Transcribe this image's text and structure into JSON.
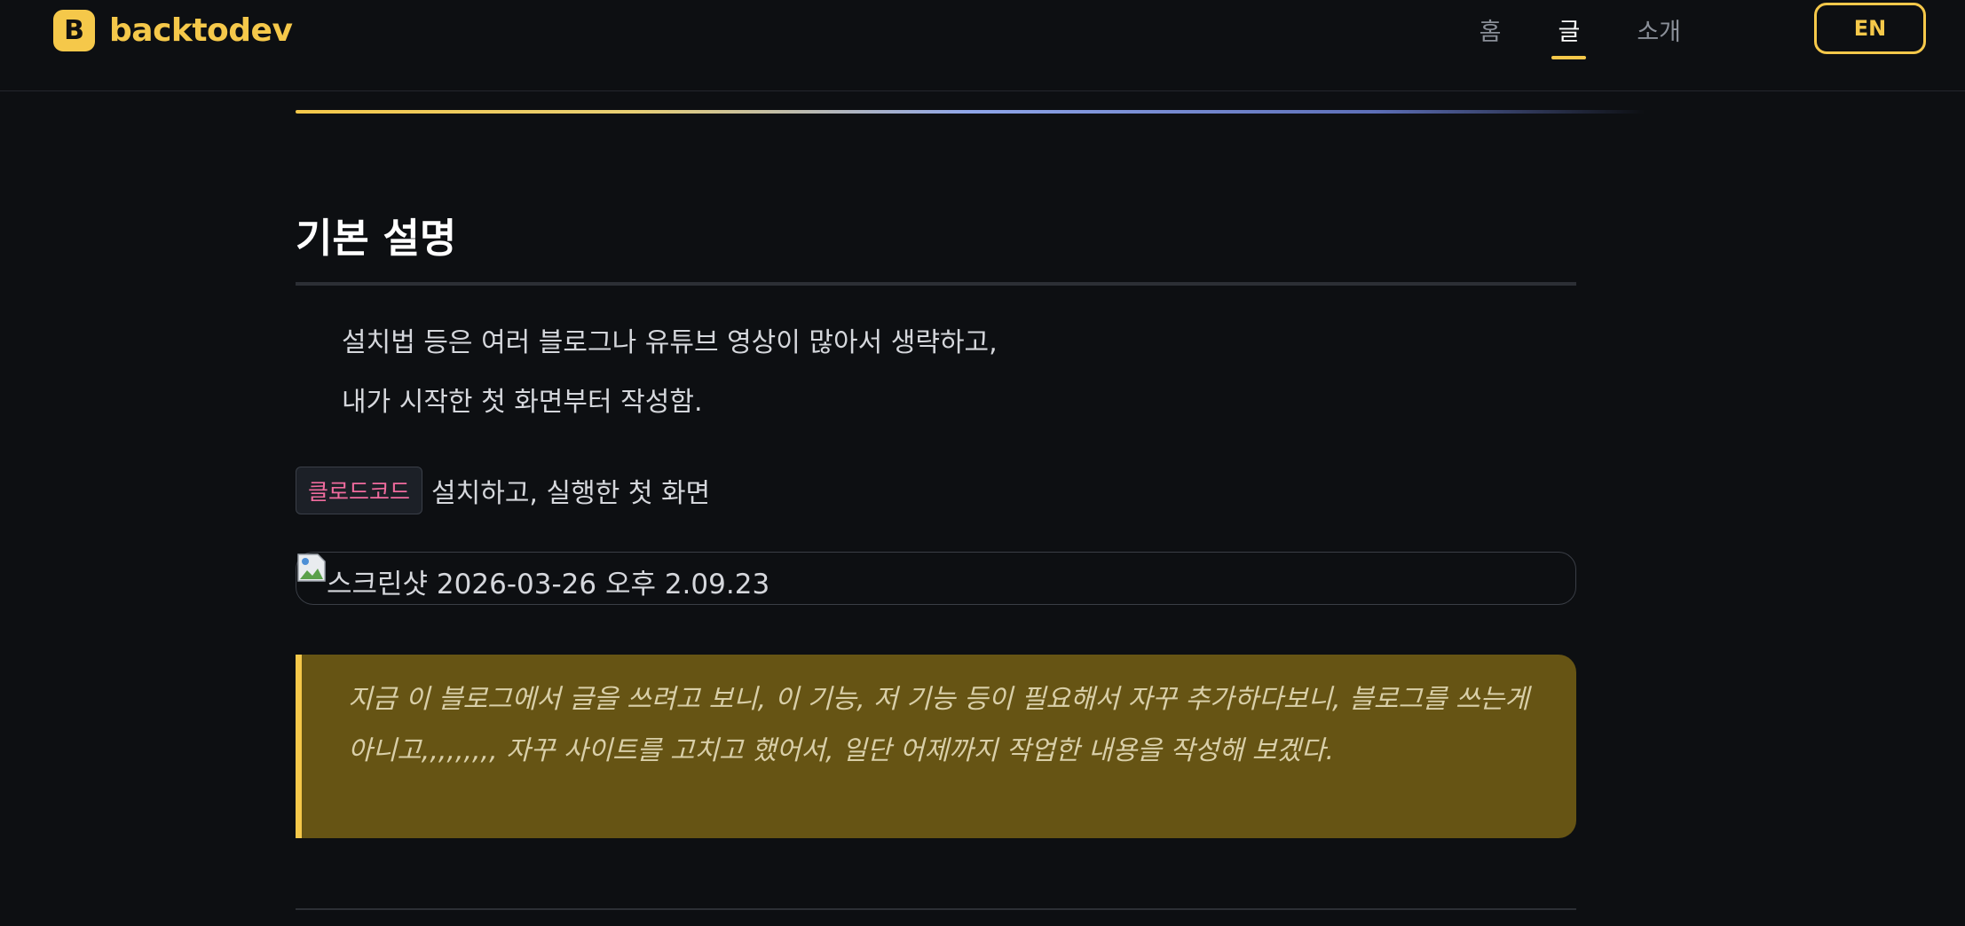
{
  "header": {
    "brand_letter": "B",
    "brand_name": "backtodev",
    "nav": [
      {
        "label": "홈",
        "active": false
      },
      {
        "label": "글",
        "active": true
      },
      {
        "label": "소개",
        "active": false
      }
    ],
    "lang_button": "EN"
  },
  "article": {
    "heading": "기본 설명",
    "paragraph_1": "설치법 등은 여러 블로그나 유튜브 영상이 많아서 생략하고,",
    "paragraph_2": "내가 시작한 첫 화면부터 작성함.",
    "code_chip": "클로드코드",
    "inline_text": "설치하고, 실행한 첫 화면",
    "image_alt": "스크린샷 2026-03-26 오후 2.09.23",
    "callout": "지금 이 블로그에서 글을 쓰려고 보니, 이 기능, 저 기능 등이 필요해서 자꾸 추가하다보니, 블로그를 쓰는게 아니고,,,,,,,,, 자꾸 사이트를 고치고 했어서, 일단 어제까지 작업한 내용을 작성해 보겠다."
  },
  "colors": {
    "accent": "#f5c84a",
    "background": "#0d0f12",
    "callout_bg": "#665414",
    "code_text": "#f06b9e"
  }
}
